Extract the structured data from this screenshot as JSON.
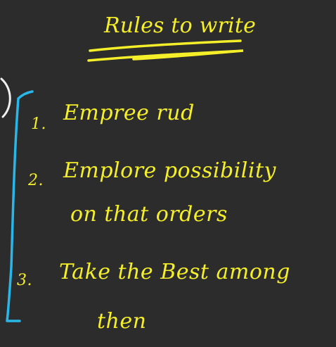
{
  "board": {
    "title": "Rules to write",
    "ink_color": "#f5ef2a",
    "bracket_color": "#29b6e8",
    "background_color": "#2c2c2c",
    "items": [
      {
        "number": "1.",
        "lines": [
          "Empree   rud"
        ]
      },
      {
        "number": "2.",
        "lines": [
          "Emplore possibility",
          "on that orders"
        ]
      },
      {
        "number": "3.",
        "lines": [
          "Take the Best among",
          "then"
        ]
      }
    ]
  }
}
